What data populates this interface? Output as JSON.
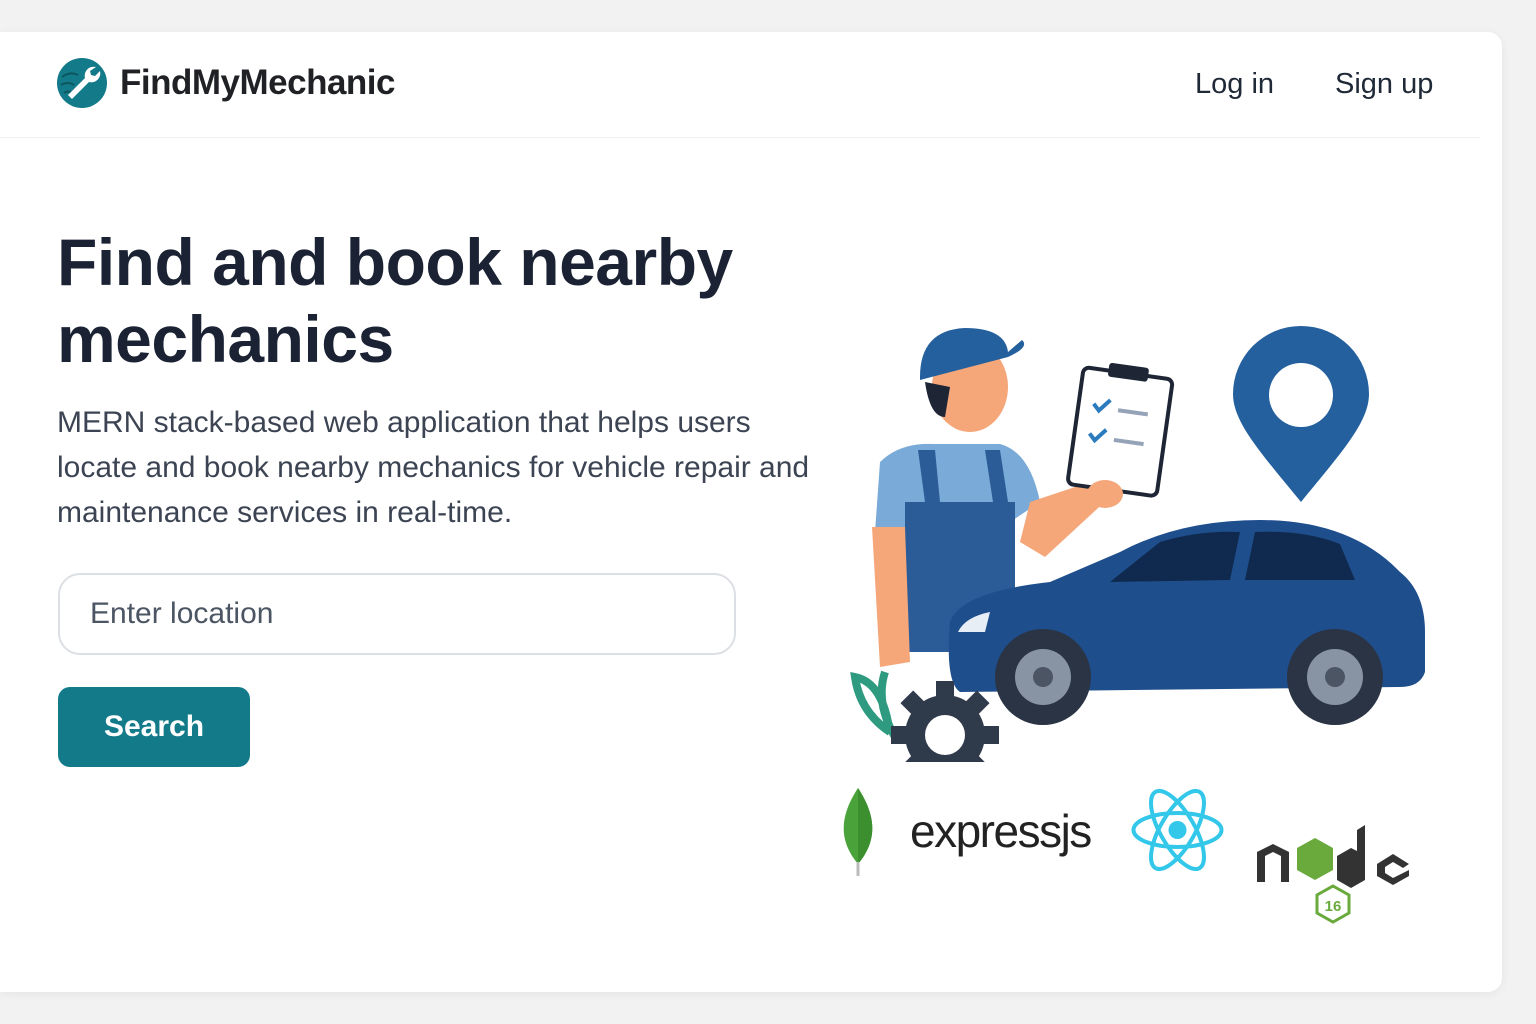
{
  "brand": {
    "name": "FindMyMechanic",
    "logo_color": "#137a8a"
  },
  "nav": {
    "login": "Log in",
    "signup": "Sign up"
  },
  "hero": {
    "title": "Find and book nearby mechanics",
    "subtitle": "MERN stack-based web application that helps users locate and book nearby mechanics for vehicle repair and maintenance services in real-time."
  },
  "search": {
    "placeholder": "Enter location",
    "value": "",
    "button": "Search"
  },
  "tech_stack": {
    "mongodb": "mongodb-leaf",
    "express": "expressjs",
    "react": "react-atom",
    "node": "node",
    "node_version": "16"
  },
  "colors": {
    "accent": "#137a8a",
    "car": "#1f4e8c",
    "pin": "#24609e"
  }
}
